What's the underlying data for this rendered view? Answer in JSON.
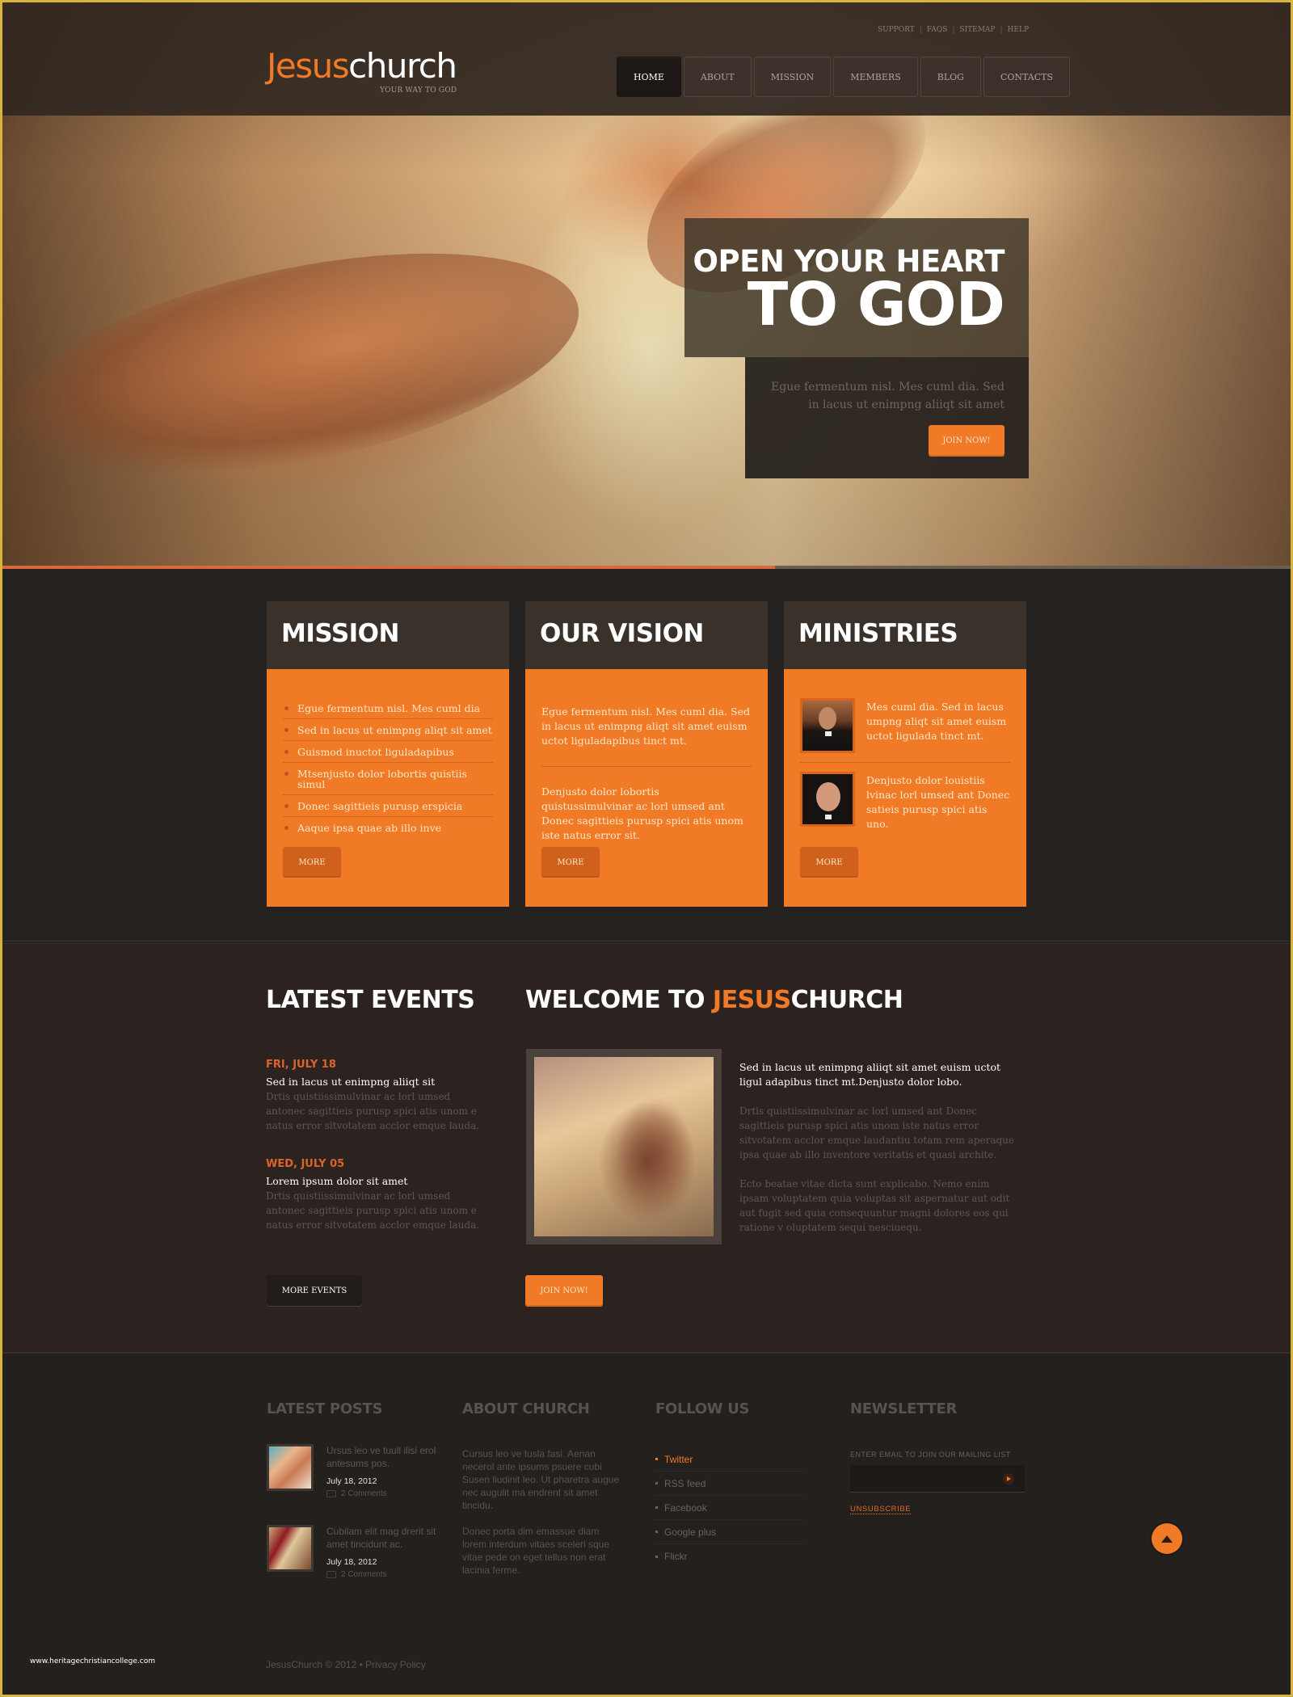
{
  "header": {
    "logo_part1": "Jesus",
    "logo_part2": "church",
    "tagline": "YOUR WAY TO GOD",
    "utility_links": [
      "SUPPORT",
      "FAQS",
      "SITEMAP",
      "HELP"
    ],
    "utility_separator": "|",
    "nav": [
      {
        "label": "HOME",
        "active": true
      },
      {
        "label": "ABOUT",
        "active": false
      },
      {
        "label": "MISSION",
        "active": false
      },
      {
        "label": "MEMBERS",
        "active": false
      },
      {
        "label": "BLOG",
        "active": false
      },
      {
        "label": "CONTACTS",
        "active": false
      }
    ]
  },
  "hero": {
    "title_line1": "OPEN YOUR HEART",
    "title_line2": "TO GOD",
    "description": "Egue fermentum nisl. Mes cuml dia. Sed in lacus ut enimpng aliiqt sit amet",
    "cta_label": "JOIN NOW!",
    "slider_progress_percent": 60
  },
  "cards": {
    "mission": {
      "title": "MISSION",
      "items": [
        "Egue fermentum nisl. Mes cuml dia",
        "Sed in lacus ut enimpng aliqt sit amet",
        "Guismod inuctot liguladapibus",
        "Mtsenjusto dolor lobortis quistiis simul",
        "Donec sagittieis purusp erspicia",
        "Aaque ipsa quae ab illo inve"
      ],
      "more_label": "MORE"
    },
    "vision": {
      "title": "OUR VISION",
      "paragraphs": [
        "Egue fermentum nisl. Mes cuml dia. Sed in lacus ut enimpng aliqt sit amet euism uctot liguladapibus tinct mt.",
        "Denjusto dolor lobortis quistussimulvinar ac lorl umsed ant Donec sagittieis purusp spici atis unom iste natus error sit."
      ],
      "more_label": "MORE"
    },
    "ministries": {
      "title": "MINISTRIES",
      "items": [
        {
          "text": "Mes cuml dia. Sed in lacus umpng aliqt sit amet euism uctot ligulada tinct mt."
        },
        {
          "text": "Denjusto dolor louistiis lvinac lorl umsed ant Donec satieis purusp spici atis uno."
        }
      ],
      "more_label": "MORE"
    }
  },
  "events": {
    "title": "LATEST EVENTS",
    "items": [
      {
        "date": "FRI, JULY 18",
        "title": "Sed in lacus ut enimpng aliiqt sit",
        "description": "Drtis quistiissimulvinar ac lorl umsed antonec sagittieis purusp spici atis unom e natus error sitvotatem acclor emque lauda."
      },
      {
        "date": "WED, JULY 05",
        "title": "Lorem ipsum dolor sit amet",
        "description": "Drtis quistiissimulvinar ac lorl umsed antonec sagittieis purusp spici atis unom e natus error sitvotatem acclor emque lauda."
      }
    ],
    "more_label": "MORE EVENTS"
  },
  "welcome": {
    "title_prefix": "WELCOME TO ",
    "title_accent": "JESUS",
    "title_suffix": "CHURCH",
    "lead": "Sed in lacus ut enimpng aliiqt sit amet euism uctot ligul adapibus tinct mt.Denjusto dolor lobo.",
    "paragraphs": [
      "Drtis quistiissimulvinar ac lorl umsed ant Donec sagittieis purusp spici atis unom iste natus error sitvotatem acclor emque laudantiu totam rem aperaque ipsa quae ab illo inventore veritatis et quasi archite.",
      "Ecto beatae vitae dicta sunt explicabo. Nemo enim ipsam voluptatem quia voluptas sit aspernatur aut odit aut fugit sed quia consequuntur magni dolores eos qui ratione v oluptatem sequi nesciuequ."
    ],
    "cta_label": "JOIN NOW!"
  },
  "footer": {
    "latest_posts": {
      "title": "LATEST POSTS",
      "items": [
        {
          "text": "Ursus leo ve tuull ilisi erol antesums pos.",
          "date": "July 18, 2012",
          "comments": "2 Comments"
        },
        {
          "text": "Cubilam elit mag drerit sit amet tincidunt ac.",
          "date": "July 18, 2012",
          "comments": "2 Comments"
        }
      ]
    },
    "about": {
      "title": "ABOUT CHURCH",
      "paragraphs": [
        "Cursus leo ve tusla fasi. Aenan necerol ante ipsums psuere cubi Susen liudinit leo. Ut pharetra augue nec augulit ma endrent sit amet tincidu.",
        "Donec porta dim emassue diam lorem interdum vitaes sceleri sque vitae pede on eget tellus non erat lacinia ferme."
      ]
    },
    "follow": {
      "title": "FOLLOW  US",
      "items": [
        {
          "label": "Twitter",
          "active": true
        },
        {
          "label": "RSS feed",
          "active": false
        },
        {
          "label": "Facebook",
          "active": false
        },
        {
          "label": "Google plus",
          "active": false
        },
        {
          "label": "Flickr",
          "active": false
        }
      ]
    },
    "newsletter": {
      "title": "NEWSLETTER",
      "label": "ENTER EMAIL TO JOIN OUR MAILING LIST",
      "input_value": "",
      "unsubscribe_label": "UNSUBSCRIBE"
    },
    "copyright": "JesusChurch © 2012 • Privacy Policy"
  },
  "watermark": "www.heritagechristiancollege.com",
  "colors": {
    "accent": "#f07a26",
    "background": "#262320",
    "frame": "#d9b43a"
  }
}
